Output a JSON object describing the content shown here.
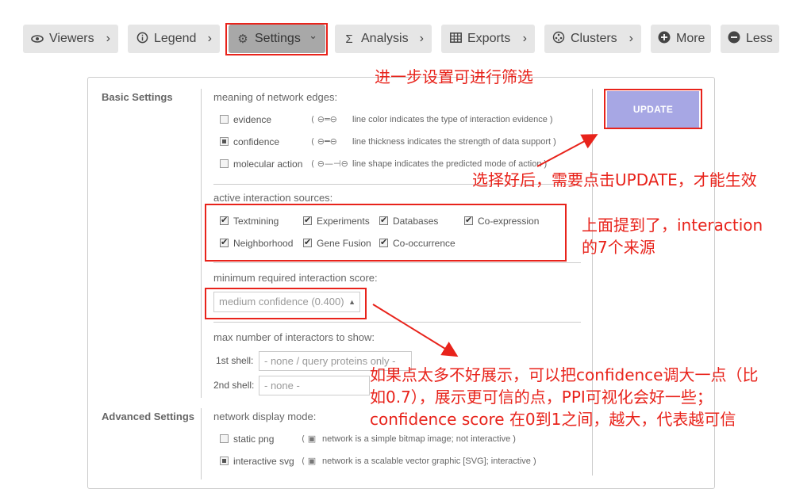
{
  "toolbar": {
    "items": [
      {
        "label": "Viewers",
        "icon": "eye-icon"
      },
      {
        "label": "Legend",
        "icon": "info-icon"
      },
      {
        "label": "Settings",
        "icon": "gear-icon"
      },
      {
        "label": "Analysis",
        "icon": "sigma-icon"
      },
      {
        "label": "Exports",
        "icon": "table-icon"
      },
      {
        "label": "Clusters",
        "icon": "clusters-icon"
      },
      {
        "label": "More",
        "icon": "plus-circle-icon"
      },
      {
        "label": "Less",
        "icon": "minus-circle-icon"
      }
    ]
  },
  "panel": {
    "basic_label": "Basic Settings",
    "advanced_label": "Advanced Settings",
    "edges": {
      "heading": "meaning of network edges:",
      "options": [
        {
          "label": "evidence",
          "state": "unchecked",
          "symbol": "( ⊖═⊖",
          "desc": "line color indicates the type of interaction evidence )"
        },
        {
          "label": "confidence",
          "state": "selected",
          "symbol": "( ⊖━⊖",
          "desc": "line thickness indicates the strength of data support )"
        },
        {
          "label": "molecular action",
          "state": "unchecked",
          "symbol": "( ⊖—⊣⊖",
          "desc": "line shape indicates the predicted mode of action )"
        }
      ]
    },
    "sources": {
      "heading": "active interaction sources:",
      "items": [
        "Textmining",
        "Experiments",
        "Databases",
        "Co-expression",
        "Neighborhood",
        "Gene Fusion",
        "Co-occurrence"
      ]
    },
    "score": {
      "heading": "minimum required interaction score:",
      "value": "medium confidence (0.400)"
    },
    "interactors": {
      "heading": "max number of interactors to show:",
      "shell1_label": "1st shell:",
      "shell1_value": "- none / query proteins only -",
      "shell2_label": "2nd shell:",
      "shell2_value": "- none -"
    },
    "display": {
      "heading": "network display mode:",
      "options": [
        {
          "label": "static png",
          "state": "unchecked",
          "desc": "network is a simple bitmap image; not interactive )"
        },
        {
          "label": "interactive svg",
          "state": "selected",
          "desc": "network is a scalable vector graphic [SVG]; interactive )"
        }
      ]
    },
    "update_label": "UPDATE"
  },
  "annotations": {
    "note1": "进一步设置可进行筛选",
    "note2": "选择好后，需要点击UPDATE，才能生效",
    "note3_line1": "上面提到了，interaction",
    "note3_line2": "的7个来源",
    "note4_line1": "如果点太多不好展示，可以把confidence调大一点（比",
    "note4_line2": "如0.7），展示更可信的点，PPI可视化会好一些；",
    "note4_line3": "confidence score 在0到1之间，越大，代表越可信"
  },
  "colors": {
    "annotation_red": "#e8231b",
    "update_button": "#a7a7e4",
    "toolbar_bg": "#e6e6e6",
    "toolbar_selected": "#a8a8a8"
  }
}
